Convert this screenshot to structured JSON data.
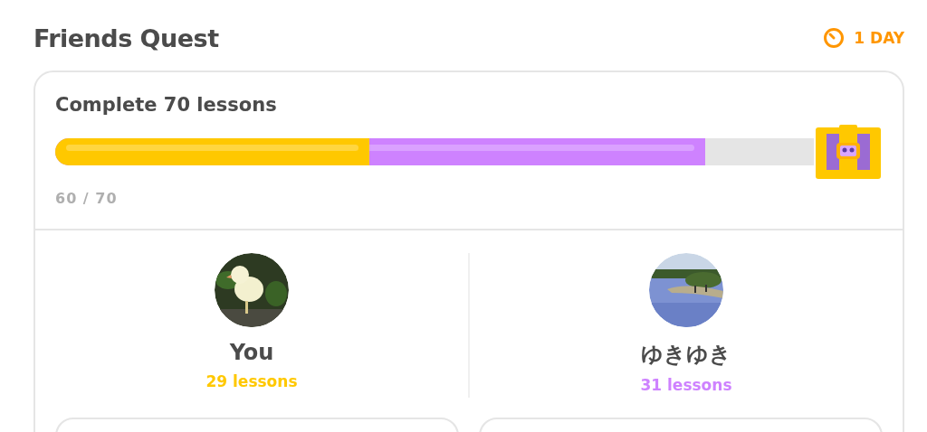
{
  "header": {
    "title": "Friends Quest",
    "timer": "1 DAY"
  },
  "quest": {
    "goal": "Complete 70 lessons",
    "progress_text": "60 / 70",
    "segments": [
      {
        "level": 0.414,
        "color": "#ffc800"
      },
      {
        "level": 0.857,
        "color": "#ce82ff"
      }
    ]
  },
  "members": [
    {
      "name": "You",
      "lessons": "29 lessons",
      "color": "#ffc800"
    },
    {
      "name": "ゆきゆき",
      "lessons": "31 lessons",
      "color": "#ce82ff"
    }
  ]
}
